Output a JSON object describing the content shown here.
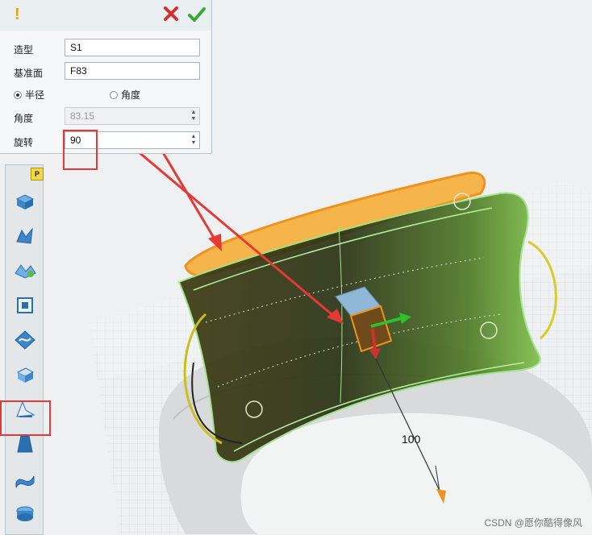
{
  "dialog": {
    "fields": [
      {
        "label": "造型",
        "value": "S1"
      },
      {
        "label": "基准面",
        "value": "F83"
      }
    ],
    "radio_radius": "半径",
    "radio_angle": "角度",
    "angle_label": "角度",
    "angle_value": "83.15",
    "rotate_label": "旋转",
    "rotate_value": "90"
  },
  "icons": {
    "warning": "exclamation-icon",
    "cancel": "red-x-icon",
    "confirm": "green-check-icon",
    "pin": "pin-icon"
  },
  "toolbar": {
    "tools": [
      "extrude-icon",
      "sweep-icon",
      "loft-icon",
      "inset-icon",
      "wrap-icon",
      "shell-icon",
      "drape-icon",
      "taper-icon",
      "twist-icon",
      "deform-icon"
    ]
  },
  "viewport": {
    "dimension_label": "100"
  },
  "watermark": "CSDN @愿你酷得像风",
  "colors": {
    "annotation": "#e53935",
    "selection_orange": "#f0921e",
    "preview_green": "#7fe07a"
  }
}
